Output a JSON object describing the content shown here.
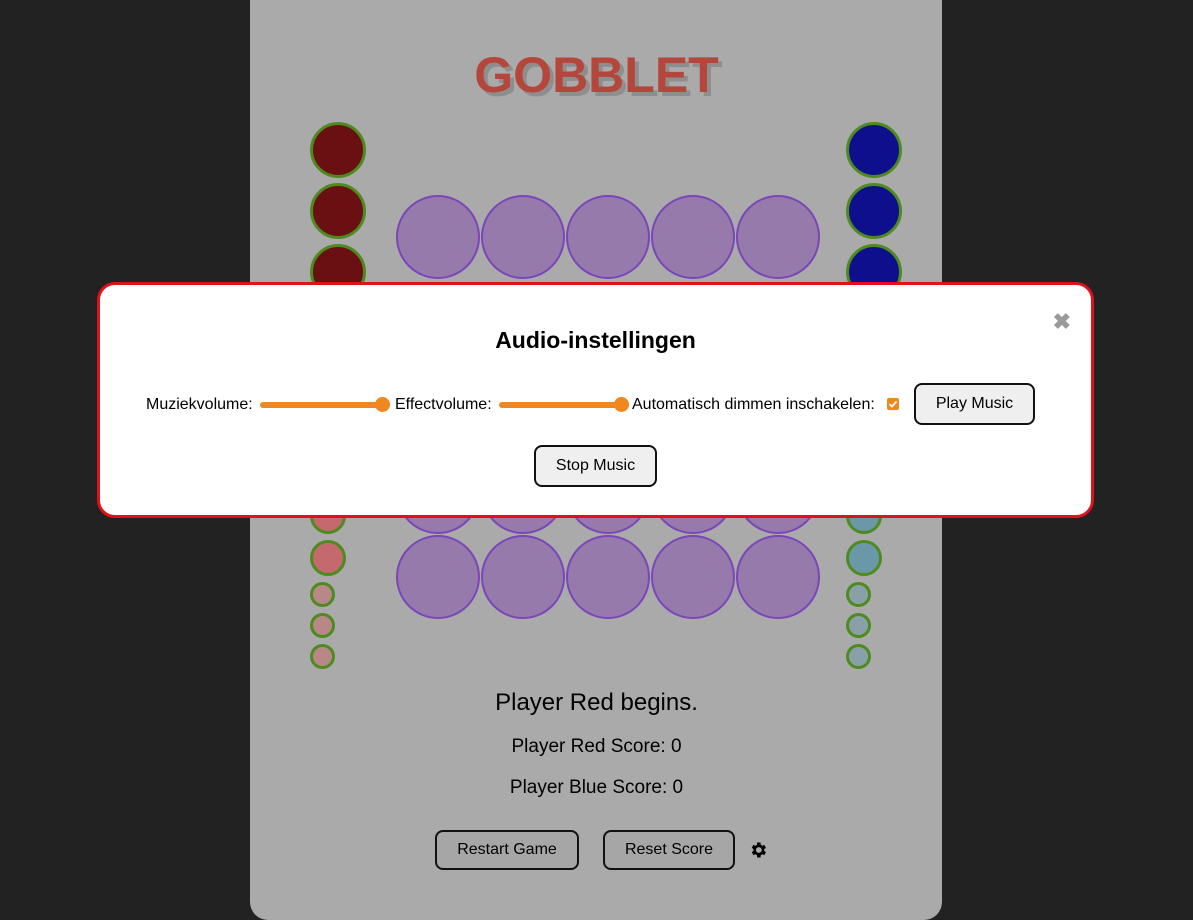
{
  "game": {
    "title": "GOBBLET",
    "status": "Player Red begins.",
    "red_score": "Player Red Score: 0",
    "blue_score": "Player Blue Score: 0",
    "restart_label": "Restart Game",
    "reset_label": "Reset Score",
    "settings_icon": "gear-icon",
    "board_rows_visible": 2,
    "board_cols": 5
  },
  "modal": {
    "title": "Audio-instellingen",
    "close_icon": "close-icon",
    "music_volume_label": "Muziekvolume:",
    "music_volume_value": 1.0,
    "effect_volume_label": "Effectvolume:",
    "effect_volume_value": 1.0,
    "auto_dim_label": "Automatisch dimmen inschakelen:",
    "auto_dim_checked": true,
    "play_label": "Play Music",
    "stop_label": "Stop Music"
  },
  "colors": {
    "background": "#222222",
    "panel": "#aaaaaa",
    "title": "#b5463b",
    "red_piece": "#6a0f12",
    "blue_piece": "#0d0f8c",
    "board_cell": "#967aac",
    "modal_border": "#e0111a",
    "accent": "#f0871f"
  }
}
